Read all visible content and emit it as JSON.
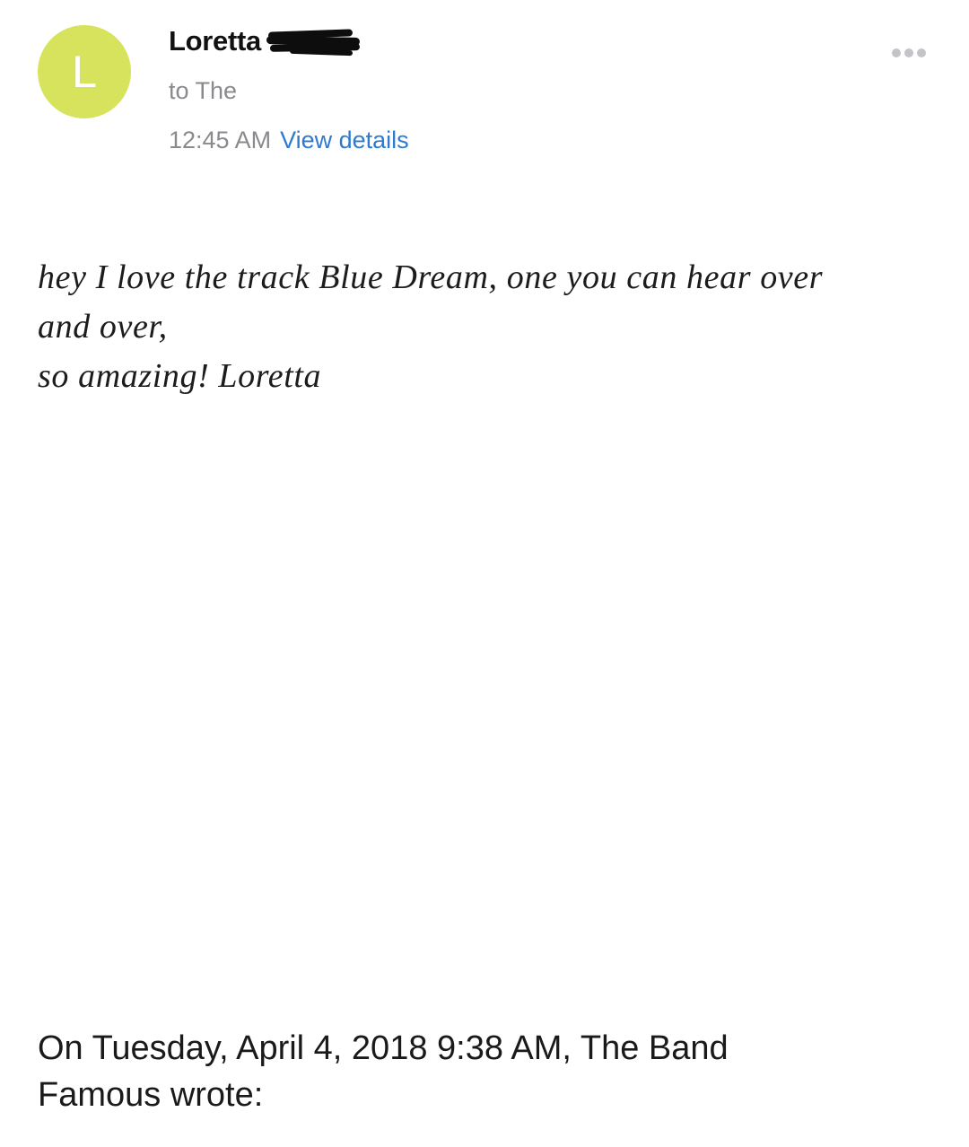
{
  "message_header": {
    "avatar_letter": "L",
    "avatar_color": "#d7e35c",
    "sender_name": "Loretta",
    "sender_surname_redacted": true,
    "recipient": "to The",
    "time": "12:45 AM",
    "view_details_label": "View details",
    "more_icon": "ellipsis-icon"
  },
  "message_body": {
    "lines": [
      "hey I love the track Blue Dream, one you can hear over",
      "and over,",
      "so amazing! Loretta"
    ]
  },
  "quoted_reply": {
    "lines": [
      "On Tuesday, April 4, 2018 9:38 AM, The Band",
      "Famous wrote:"
    ]
  },
  "colors": {
    "link": "#2f7ad1",
    "secondary_text": "#8a8a8e"
  }
}
